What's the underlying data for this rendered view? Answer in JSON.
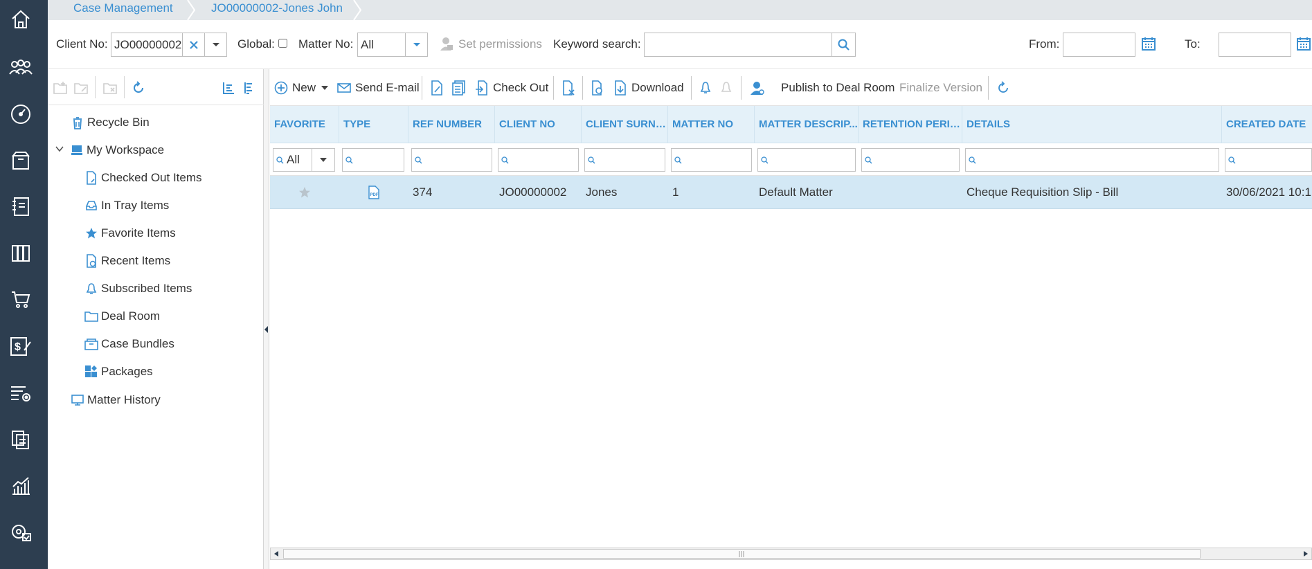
{
  "sidebar": {
    "icons": [
      "home-icon",
      "people-icon",
      "dashboard-icon",
      "archive-box-icon",
      "address-book-icon",
      "library-icon",
      "cart-icon",
      "billing-icon",
      "settings-list-icon",
      "copy-docs-icon",
      "analytics-chart-icon",
      "admin-settings-icon"
    ]
  },
  "breadcrumb": {
    "items": [
      "Case Management",
      "JO00000002-Jones John"
    ]
  },
  "filters": {
    "client_no_label": "Client No:",
    "client_no_value": "JO00000002",
    "global_label": "Global:",
    "matter_no_label": "Matter No:",
    "matter_no_value": "All",
    "set_permissions_label": "Set permissions",
    "keyword_search_label": "Keyword search:",
    "keyword_search_value": "",
    "from_label": "From:",
    "from_value": "",
    "to_label": "To:",
    "to_value": ""
  },
  "tree": {
    "items": [
      {
        "label": "Recycle Bin",
        "icon": "recycle-bin-icon"
      },
      {
        "label": "My Workspace",
        "icon": "workspace-icon"
      },
      {
        "label": "Checked Out Items",
        "icon": "checked-out-icon"
      },
      {
        "label": "In Tray Items",
        "icon": "in-tray-icon"
      },
      {
        "label": "Favorite Items",
        "icon": "star-icon"
      },
      {
        "label": "Recent Items",
        "icon": "recent-doc-icon"
      },
      {
        "label": "Subscribed Items",
        "icon": "bell-icon"
      },
      {
        "label": "Deal Room",
        "icon": "folder-icon"
      },
      {
        "label": "Case Bundles",
        "icon": "bundle-icon"
      },
      {
        "label": "Packages",
        "icon": "packages-icon"
      },
      {
        "label": "Matter History",
        "icon": "history-icon"
      }
    ]
  },
  "toolbar": {
    "new_label": "New",
    "send_email_label": "Send E-mail",
    "check_out_label": "Check Out",
    "download_label": "Download",
    "publish_label": "Publish to Deal Room",
    "finalize_label": "Finalize Version"
  },
  "grid": {
    "columns": [
      "FAVORITE",
      "TYPE",
      "REF NUMBER",
      "CLIENT NO",
      "CLIENT SURNA...",
      "MATTER NO",
      "MATTER DESCRIP...",
      "RETENTION PERIOD",
      "DETAILS",
      "CREATED DATE"
    ],
    "favorite_filter_value": "All",
    "rows": [
      {
        "favorite": "",
        "type": "pdf-icon",
        "ref_number": "374",
        "client_no": "JO00000002",
        "client_surname": "Jones",
        "matter_no": "1",
        "matter_description": "Default Matter",
        "retention_period": "",
        "details": "Cheque Requisition Slip - Bill",
        "created_date": "30/06/2021 10:1"
      }
    ]
  },
  "colors": {
    "sidebar_bg": "#2d3e50",
    "accent": "#3a8fd1",
    "header_bg": "#e4f1f9",
    "selected_row_bg": "#d3e8f5"
  }
}
